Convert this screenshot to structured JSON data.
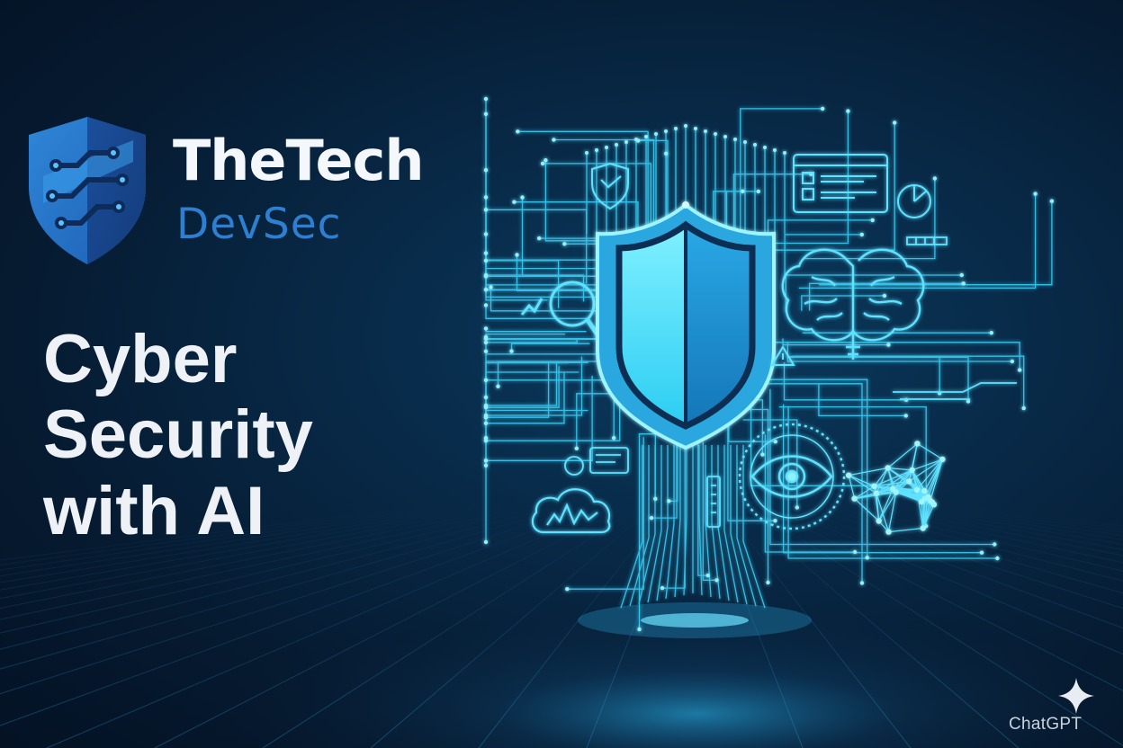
{
  "brand": {
    "name": "TheTech",
    "subname": "DevSec",
    "logo_icon": "circuit-shield-icon",
    "name_color": "#f4f7fb",
    "subname_color": "#2f7fd0"
  },
  "headline": {
    "lines": [
      "Cyber",
      "Security",
      "with AI"
    ],
    "color": "#eef2f6"
  },
  "illustration": {
    "icons": [
      "shield-icon",
      "brain-icon",
      "eye-icon",
      "magnifier-icon",
      "network-mesh-icon",
      "cloud-chart-icon",
      "warning-icon",
      "dashboard-icon"
    ],
    "accent_color": "#3fd8ff"
  },
  "watermark": {
    "text": "ChatGPT",
    "icon": "sparkle-icon"
  },
  "colors": {
    "background": "#061a30",
    "glow": "#3fd8ff"
  }
}
